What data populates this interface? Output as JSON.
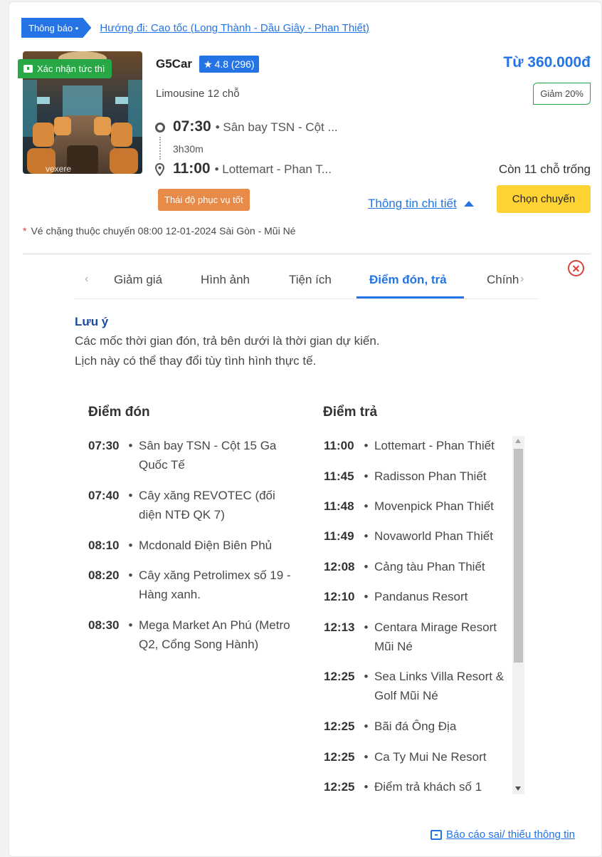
{
  "notice": {
    "badge": "Thông báo •",
    "link": "Hướng đi: Cao tốc (Long Thành - Dầu Giây - Phan Thiết)"
  },
  "trip": {
    "confirm_tag": "Xác nhận tức thì",
    "thumb_watermark": "vexere",
    "operator": "G5Car",
    "rating": "4.8 (296)",
    "price": "Từ 360.000đ",
    "bus_type": "Limousine 12 chỗ",
    "discount": "Giảm 20%",
    "depart_time": "07:30",
    "depart_place": "• Sân bay TSN - Cột ...",
    "duration": "3h30m",
    "arrive_time": "11:00",
    "arrive_place": "• Lottemart - Phan T...",
    "seats_left": "Còn 11 chỗ trống",
    "service_tag": "Thái độ phục vụ tốt",
    "detail_link": "Thông tin chi tiết",
    "choose_button": "Chọn chuyến",
    "note": "Vé chặng thuộc chuyến 08:00 12-01-2024 Sài Gòn - Mũi Né",
    "note_marker": "*"
  },
  "tabs": {
    "prev": "‹",
    "next": "›",
    "items": [
      "Giảm giá",
      "Hình ảnh",
      "Tiện ích",
      "Điểm đón, trả",
      "Chính sách"
    ],
    "active_index": 3
  },
  "notice_box": {
    "title": "Lưu ý",
    "line1": "Các mốc thời gian đón, trả bên dưới là thời gian dự kiến.",
    "line2": "Lịch này có thể thay đổi tùy tình hình thực tế."
  },
  "pickup": {
    "title": "Điểm đón",
    "stops": [
      {
        "time": "07:30",
        "place": "Sân bay TSN - Cột 15 Ga Quốc Tế"
      },
      {
        "time": "07:40",
        "place": "Cây xăng REVOTEC (đối diện NTĐ QK 7)"
      },
      {
        "time": "08:10",
        "place": "Mcdonald Điện Biên Phủ"
      },
      {
        "time": "08:20",
        "place": "Cây xăng Petrolimex số 19 - Hàng xanh."
      },
      {
        "time": "08:30",
        "place": "Mega Market An Phú (Metro Q2, Cổng Song Hành)"
      }
    ]
  },
  "dropoff": {
    "title": "Điểm trả",
    "stops": [
      {
        "time": "11:00",
        "place": "Lottemart - Phan Thiết"
      },
      {
        "time": "11:45",
        "place": "Radisson Phan Thiết"
      },
      {
        "time": "11:48",
        "place": "Movenpick Phan Thiết"
      },
      {
        "time": "11:49",
        "place": "Novaworld Phan Thiết"
      },
      {
        "time": "12:08",
        "place": "Cảng tàu Phan Thiết"
      },
      {
        "time": "12:10",
        "place": "Pandanus Resort"
      },
      {
        "time": "12:13",
        "place": "Centara Mirage Resort Mũi Né"
      },
      {
        "time": "12:25",
        "place": "Sea Links Villa Resort & Golf Mũi Né"
      },
      {
        "time": "12:25",
        "place": "Bãi đá Ông Địa"
      },
      {
        "time": "12:25",
        "place": "Ca Ty Mui Ne Resort"
      },
      {
        "time": "12:25",
        "place": "Điểm trả khách số 1"
      }
    ]
  },
  "report_link": "Báo cáo sai/ thiếu thông tin",
  "colors": {
    "accent": "#2474e5",
    "confirm": "#27a745",
    "service": "#e88a48",
    "cta": "#ffd333",
    "close": "#d9423a"
  }
}
